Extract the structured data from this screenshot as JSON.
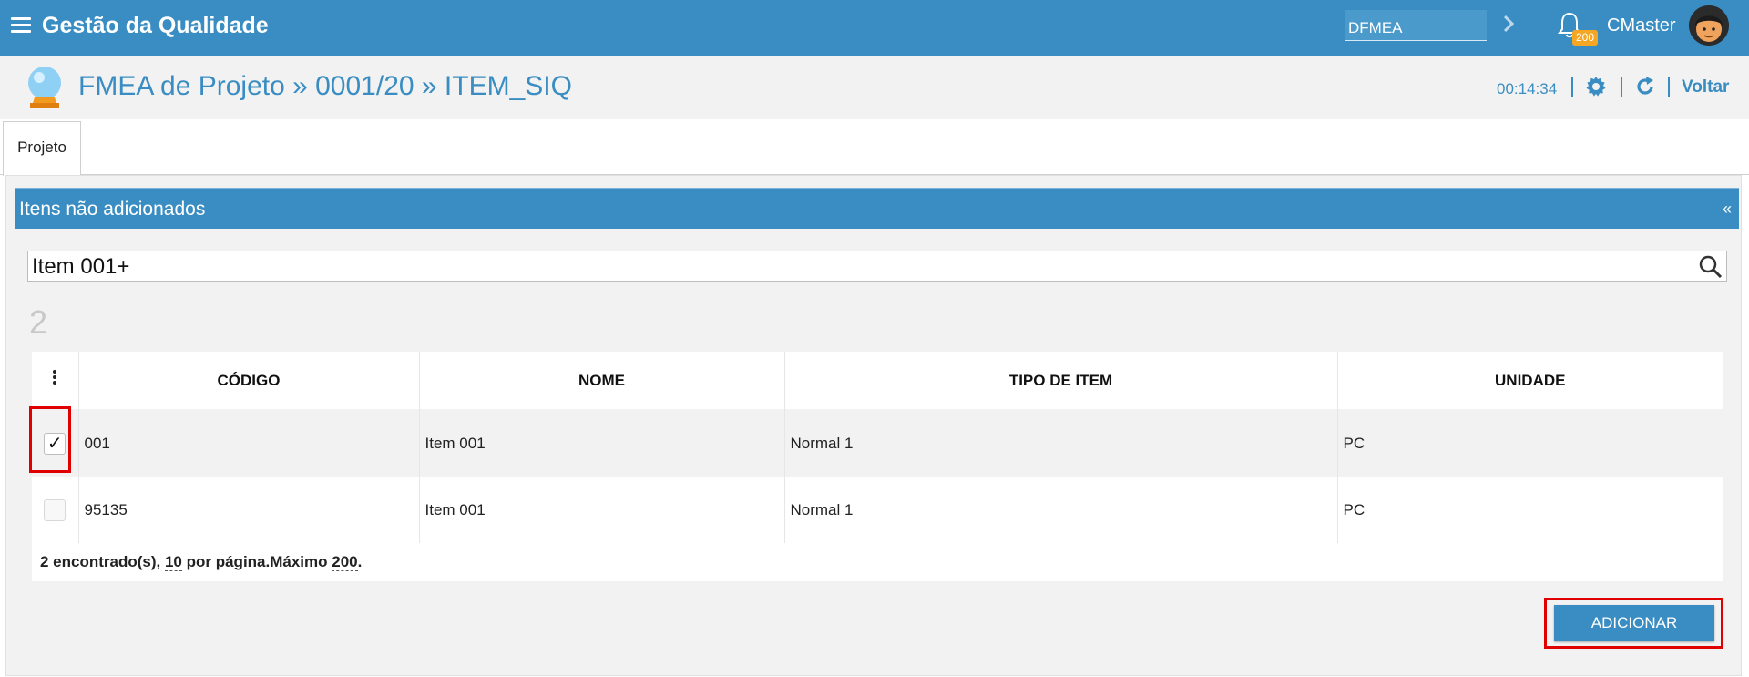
{
  "topbar": {
    "app_title": "Gestão da Qualidade",
    "module_value": "DFMEA",
    "notification_count": "200",
    "username": "CMaster"
  },
  "header": {
    "breadcrumb": "FMEA de Projeto » 0001/20 » ITEM_SIQ",
    "timer": "00:14:34",
    "back_label": "Voltar"
  },
  "tabs": [
    {
      "label": "Projeto"
    }
  ],
  "panel": {
    "title": "Itens não adicionados",
    "collapse_label": "«",
    "search_value": "Item 001+",
    "result_count": "2"
  },
  "table": {
    "columns": [
      "CÓDIGO",
      "NOME",
      "TIPO DE ITEM",
      "UNIDADE"
    ],
    "rows": [
      {
        "checked": true,
        "check_mark": "✓",
        "codigo": "001",
        "nome": "Item 001",
        "tipo": "Normal 1",
        "unidade": "PC"
      },
      {
        "checked": false,
        "check_mark": "",
        "codigo": "95135",
        "nome": "Item 001",
        "tipo": "Normal 1",
        "unidade": "PC"
      }
    ],
    "footer": {
      "found": "2 encontrado(s), ",
      "per_page": "10",
      "per_page_suffix": " por página.Máximo ",
      "max": "200",
      "end": "."
    }
  },
  "actions": {
    "add_label": "ADICIONAR"
  },
  "colors": {
    "primary": "#3a8dc2",
    "badge": "#f5a623",
    "highlight": "#e00000"
  }
}
